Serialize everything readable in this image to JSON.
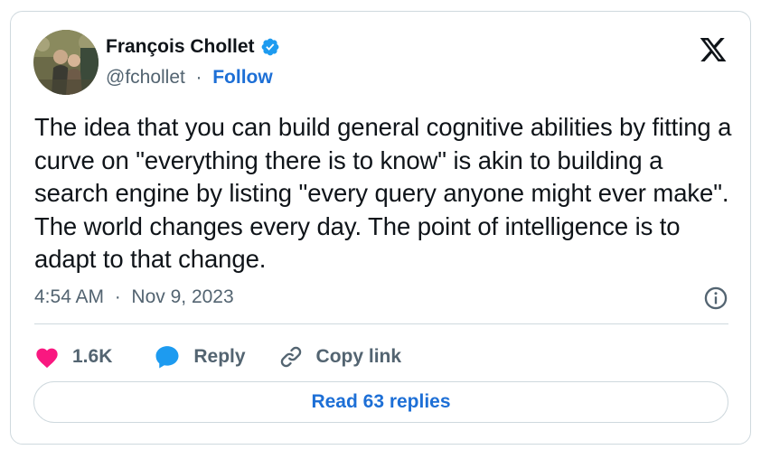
{
  "author": {
    "name": "François Chollet",
    "handle": "@fchollet",
    "separator": "·",
    "follow_label": "Follow",
    "verified_icon": "verified-badge-icon"
  },
  "tweet": {
    "text": "The idea that you can build general cognitive abilities by fitting a curve on \"everything there is to know\" is akin to building a search engine by listing \"every query anyone might ever make\". The world changes every day. The point of intelligence is to adapt to that change.",
    "time": "4:54 AM",
    "date_separator": "·",
    "date": "Nov 9, 2023"
  },
  "actions": {
    "like_count": "1.6K",
    "reply_label": "Reply",
    "copy_link_label": "Copy link"
  },
  "footer": {
    "read_replies_label": "Read 63 replies"
  },
  "colors": {
    "accent": "#1d6fd6",
    "like": "#f91880",
    "reply_icon": "#1d9bf0",
    "muted_text": "#536471",
    "border": "#cfd9de"
  },
  "icons": {
    "platform_logo": "x-logo-icon",
    "info": "info-icon",
    "like": "heart-icon",
    "reply": "speech-bubble-icon",
    "copy_link": "link-icon"
  }
}
